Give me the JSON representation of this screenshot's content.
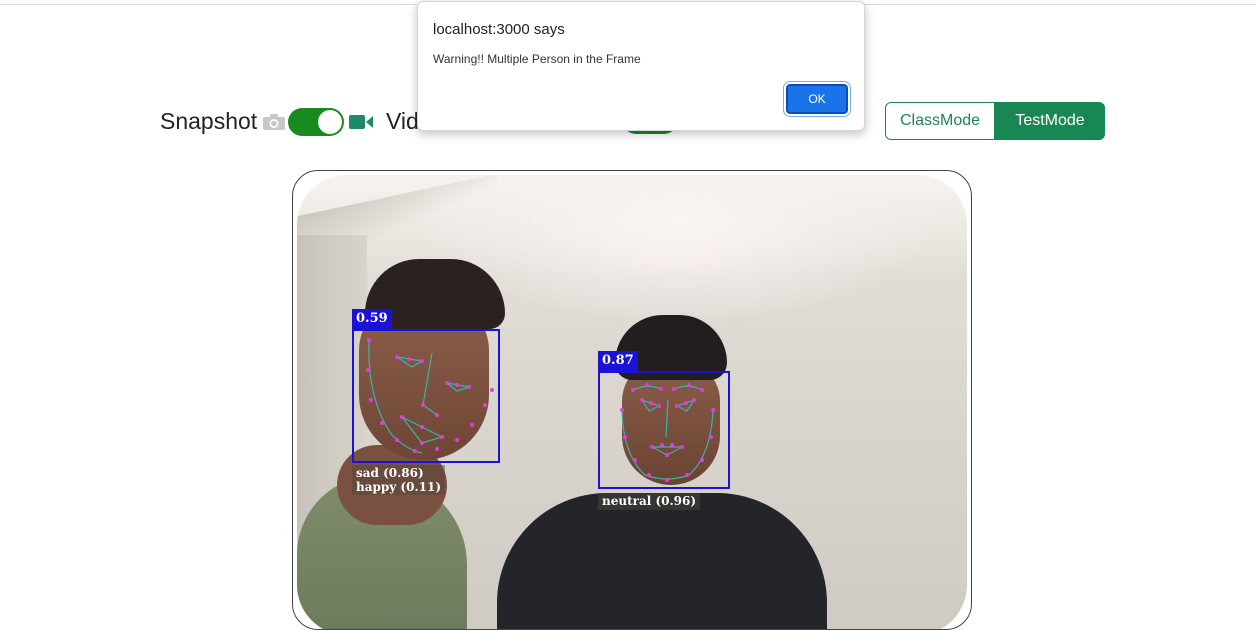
{
  "controls": {
    "snapshot_label": "Snapshot",
    "video_label_visible": "Vid",
    "snapshot_icon": "camera-icon",
    "video_icon": "video-camera-icon",
    "toggle_color": "#198a1e"
  },
  "mode_buttons": {
    "class_mode": "ClassMode",
    "test_mode": "TestMode",
    "active": "TestMode",
    "accent": "#198754"
  },
  "detections": [
    {
      "score": "0.59",
      "emotions": [
        "sad (0.86)",
        "happy (0.11)"
      ]
    },
    {
      "score": "0.87",
      "emotions": [
        "neutral (0.96)"
      ]
    }
  ],
  "dialog": {
    "title": "localhost:3000 says",
    "message": "Warning!! Multiple Person in the Frame",
    "ok_label": "OK"
  }
}
